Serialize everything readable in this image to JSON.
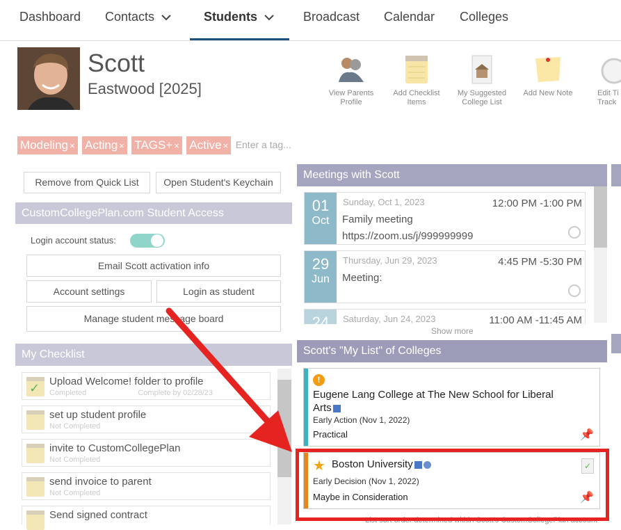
{
  "nav": {
    "items": [
      "Dashboard",
      "Contacts",
      "Students",
      "Broadcast",
      "Calendar",
      "Colleges"
    ],
    "active": "Students"
  },
  "student": {
    "first_name": "Scott",
    "last_name": "Eastwood [2025]"
  },
  "actions": [
    {
      "label": "View Parents Profile",
      "icon": "parents-icon"
    },
    {
      "label": "Add Checklist Items",
      "icon": "notepad-icon"
    },
    {
      "label": "My Suggested College List",
      "icon": "college-doc-icon"
    },
    {
      "label": "Add New Note",
      "icon": "sticky-note-icon"
    },
    {
      "label": "Edit Ti Track",
      "icon": "stopwatch-icon"
    }
  ],
  "tags": [
    "Modeling",
    "Acting",
    "TAGS+",
    "Active"
  ],
  "tag_input_placeholder": "Enter a tag...",
  "tag_remove": "×",
  "buttons": {
    "remove_quick_list": "Remove from Quick List",
    "open_keychain": "Open Student's Keychain"
  },
  "access": {
    "title": "CustomCollegePlan.com Student Access",
    "login_status_label": "Login account status:",
    "email_activation": "Email Scott activation info",
    "account_settings": "Account settings",
    "login_as_student": "Login as student",
    "manage_board": "Manage student message board"
  },
  "checklist": {
    "title": "My Checklist",
    "items": [
      {
        "title": "Upload Welcome! folder to profile",
        "status": "Completed",
        "due": "Complete by 02/28/23",
        "done": true
      },
      {
        "title": "set up student profile",
        "status": "Not Completed"
      },
      {
        "title": "invite to CustomCollegePlan",
        "status": "Not Completed"
      },
      {
        "title": "send invoice to parent",
        "status": "Not Completed"
      },
      {
        "title": "Send signed contract",
        "status": ""
      }
    ]
  },
  "meetings": {
    "title": "Meetings with Scott",
    "items": [
      {
        "day": "01",
        "month": "Oct",
        "weekday": "Sunday, Oct 1, 2023",
        "time": "12:00 PM -1:00 PM",
        "title": "Family meeting",
        "link": "https://zoom.us/j/999999999"
      },
      {
        "day": "29",
        "month": "Jun",
        "weekday": "Thursday, Jun 29, 2023",
        "time": "4:45 PM -5:30 PM",
        "title": "Meeting:",
        "link": ""
      },
      {
        "day": "24",
        "month": "Jun",
        "weekday": "Saturday, Jun 24, 2023",
        "time": "11:00 AM -11:45 AM",
        "title": "",
        "link": ""
      }
    ],
    "show_more": "Show more"
  },
  "colleges": {
    "title": "Scott's \"My List\" of Colleges",
    "items": [
      {
        "name_line1": "Eugene Lang College at The New School for Liberal",
        "name_line2": "Arts",
        "deadline": "Early Action (Nov 1, 2022)",
        "status": "Practical",
        "color": "#3ab3c3"
      },
      {
        "name_line1": "Boston University",
        "name_line2": "",
        "deadline": "Early Decision (Nov 1, 2022)",
        "status": "Maybe in Consideration",
        "color": "#e8861c"
      }
    ],
    "footer": "List sort order determined within Scott's CustomCollegePlan account"
  },
  "colors": {
    "accent": "#1d4f7c",
    "highlight": "#e52421",
    "toggle": "#8fd5c9"
  }
}
